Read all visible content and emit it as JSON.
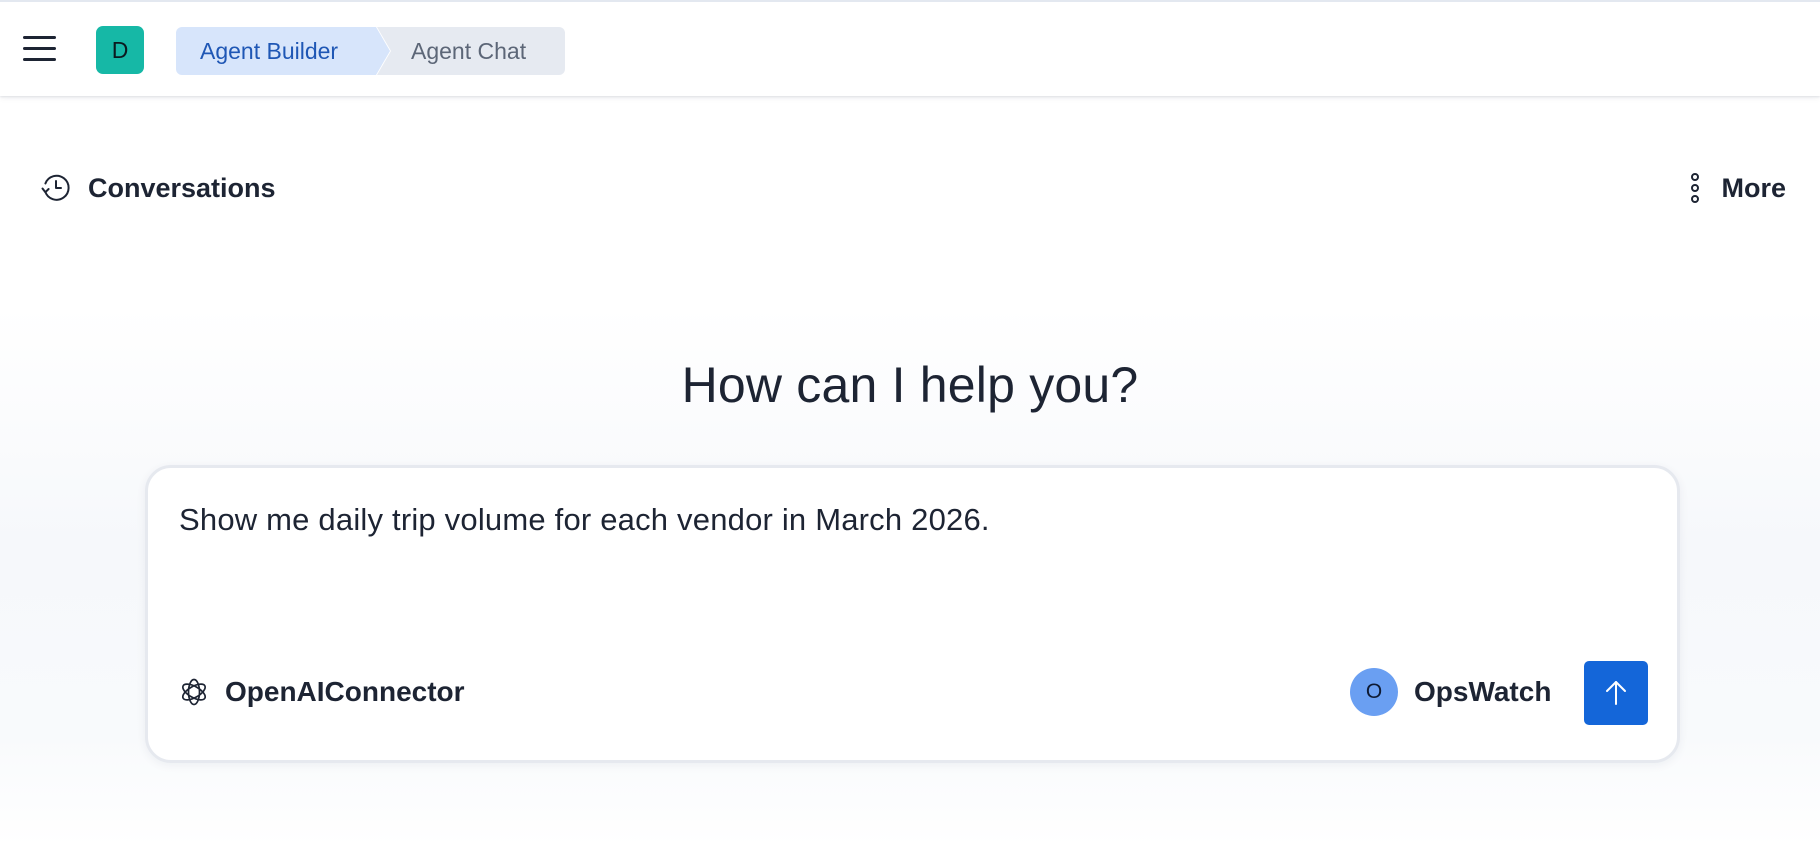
{
  "header": {
    "menu_icon": "hamburger-menu-icon",
    "space_avatar_initial": "D",
    "space_avatar_color": "#16b8a6",
    "breadcrumb": [
      {
        "label": "Agent Builder",
        "active": true
      },
      {
        "label": "Agent Chat",
        "active": false
      }
    ]
  },
  "toolbar": {
    "conversations_label": "Conversations",
    "conversations_icon": "history-clock-icon",
    "more_label": "More",
    "more_icon": "vertical-dots-icon"
  },
  "main": {
    "headline": "How can I help you?"
  },
  "prompt": {
    "value": "Show me daily trip volume for each vendor in March 2026.",
    "connector": {
      "label": "OpenAIConnector",
      "icon": "openai-logo-icon"
    },
    "agent": {
      "initial": "O",
      "label": "OpsWatch",
      "avatar_color": "#6a9ff2"
    },
    "send_icon": "arrow-up-icon",
    "send_color": "#1466d9"
  }
}
